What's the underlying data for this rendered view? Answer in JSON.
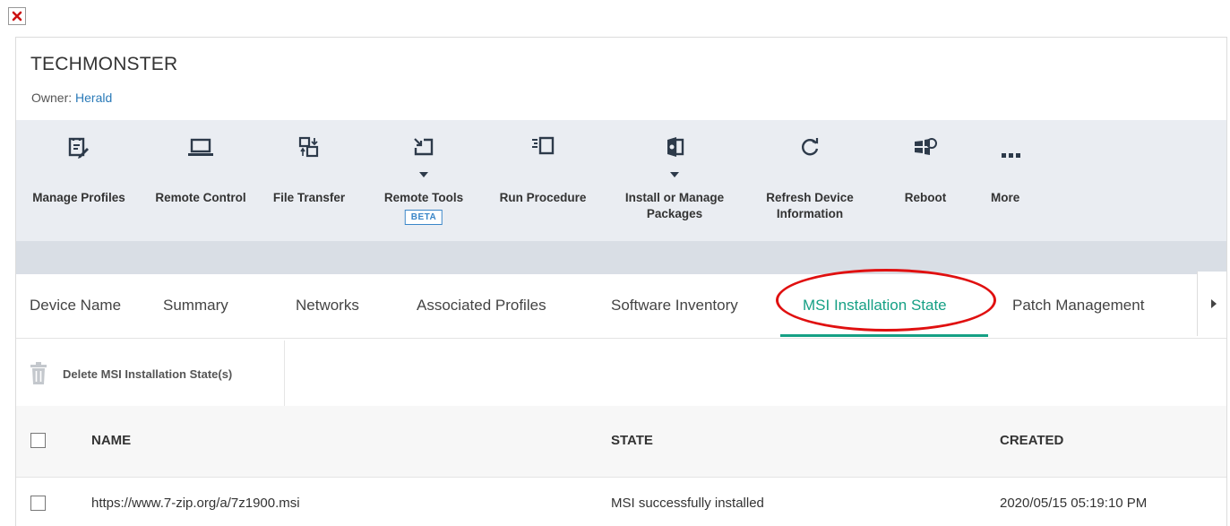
{
  "window": {
    "close_icon": "close-x-icon"
  },
  "device": {
    "title": "TECHMONSTER",
    "owner_label": "Owner:",
    "owner_name": "Herald"
  },
  "toolbar": {
    "manage_profiles": "Manage Profiles",
    "remote_control": "Remote Control",
    "file_transfer": "File Transfer",
    "remote_tools": "Remote Tools",
    "remote_tools_badge": "BETA",
    "run_procedure": "Run Procedure",
    "install_line1": "Install or Manage",
    "install_line2": "Packages",
    "refresh_line1": "Refresh Device",
    "refresh_line2": "Information",
    "reboot": "Reboot",
    "more": "More"
  },
  "tabs": {
    "device_name": "Device Name",
    "summary": "Summary",
    "networks": "Networks",
    "associated_profiles": "Associated Profiles",
    "software_inventory": "Software Inventory",
    "msi_installation_state": "MSI Installation State",
    "patch_management": "Patch Management",
    "active": "MSI Installation State"
  },
  "actions": {
    "delete_label": "Delete MSI Installation State(s)"
  },
  "table": {
    "headers": {
      "name": "NAME",
      "state": "STATE",
      "created": "CREATED"
    },
    "rows": [
      {
        "name": "https://www.7-zip.org/a/7z1900.msi",
        "state": "MSI successfully installed",
        "created": "2020/05/15 05:19:10 PM"
      }
    ]
  },
  "colors": {
    "accent": "#16a085",
    "highlight_ellipse": "#e01010",
    "link": "#2a7ab8",
    "toolbar_bg": "#eaedf2"
  }
}
